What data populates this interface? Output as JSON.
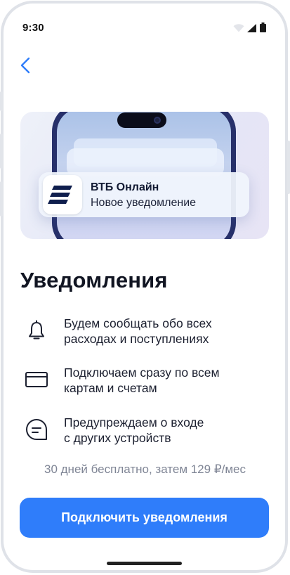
{
  "status_bar": {
    "time": "9:30",
    "icons": [
      "wifi-icon",
      "signal-icon",
      "battery-icon"
    ]
  },
  "navigation": {
    "back_icon": "chevron-left-icon"
  },
  "hero": {
    "notification": {
      "app_name": "ВТБ Онлайн",
      "message": "Новое уведомление",
      "app_icon": "vtb-logo-icon"
    }
  },
  "title": "Уведомления",
  "features": [
    {
      "icon": "bell-icon",
      "line1": "Будем сообщать обо всех",
      "line2": "расходах и поступлениях"
    },
    {
      "icon": "card-icon",
      "line1": "Подключаем сразу по всем",
      "line2": "картам и счетам"
    },
    {
      "icon": "chat-bubble-icon",
      "line1": "Предупреждаем о входе",
      "line2": "с других устройств"
    }
  ],
  "pricing_text": "30 дней бесплатно, затем 129 ₽/мес",
  "connect_button_label": "Подключить уведомления",
  "colors": {
    "accent": "#2f7dfa",
    "phone_frame": "#27306a",
    "text_primary": "#111522",
    "text_secondary": "#7f8595"
  }
}
